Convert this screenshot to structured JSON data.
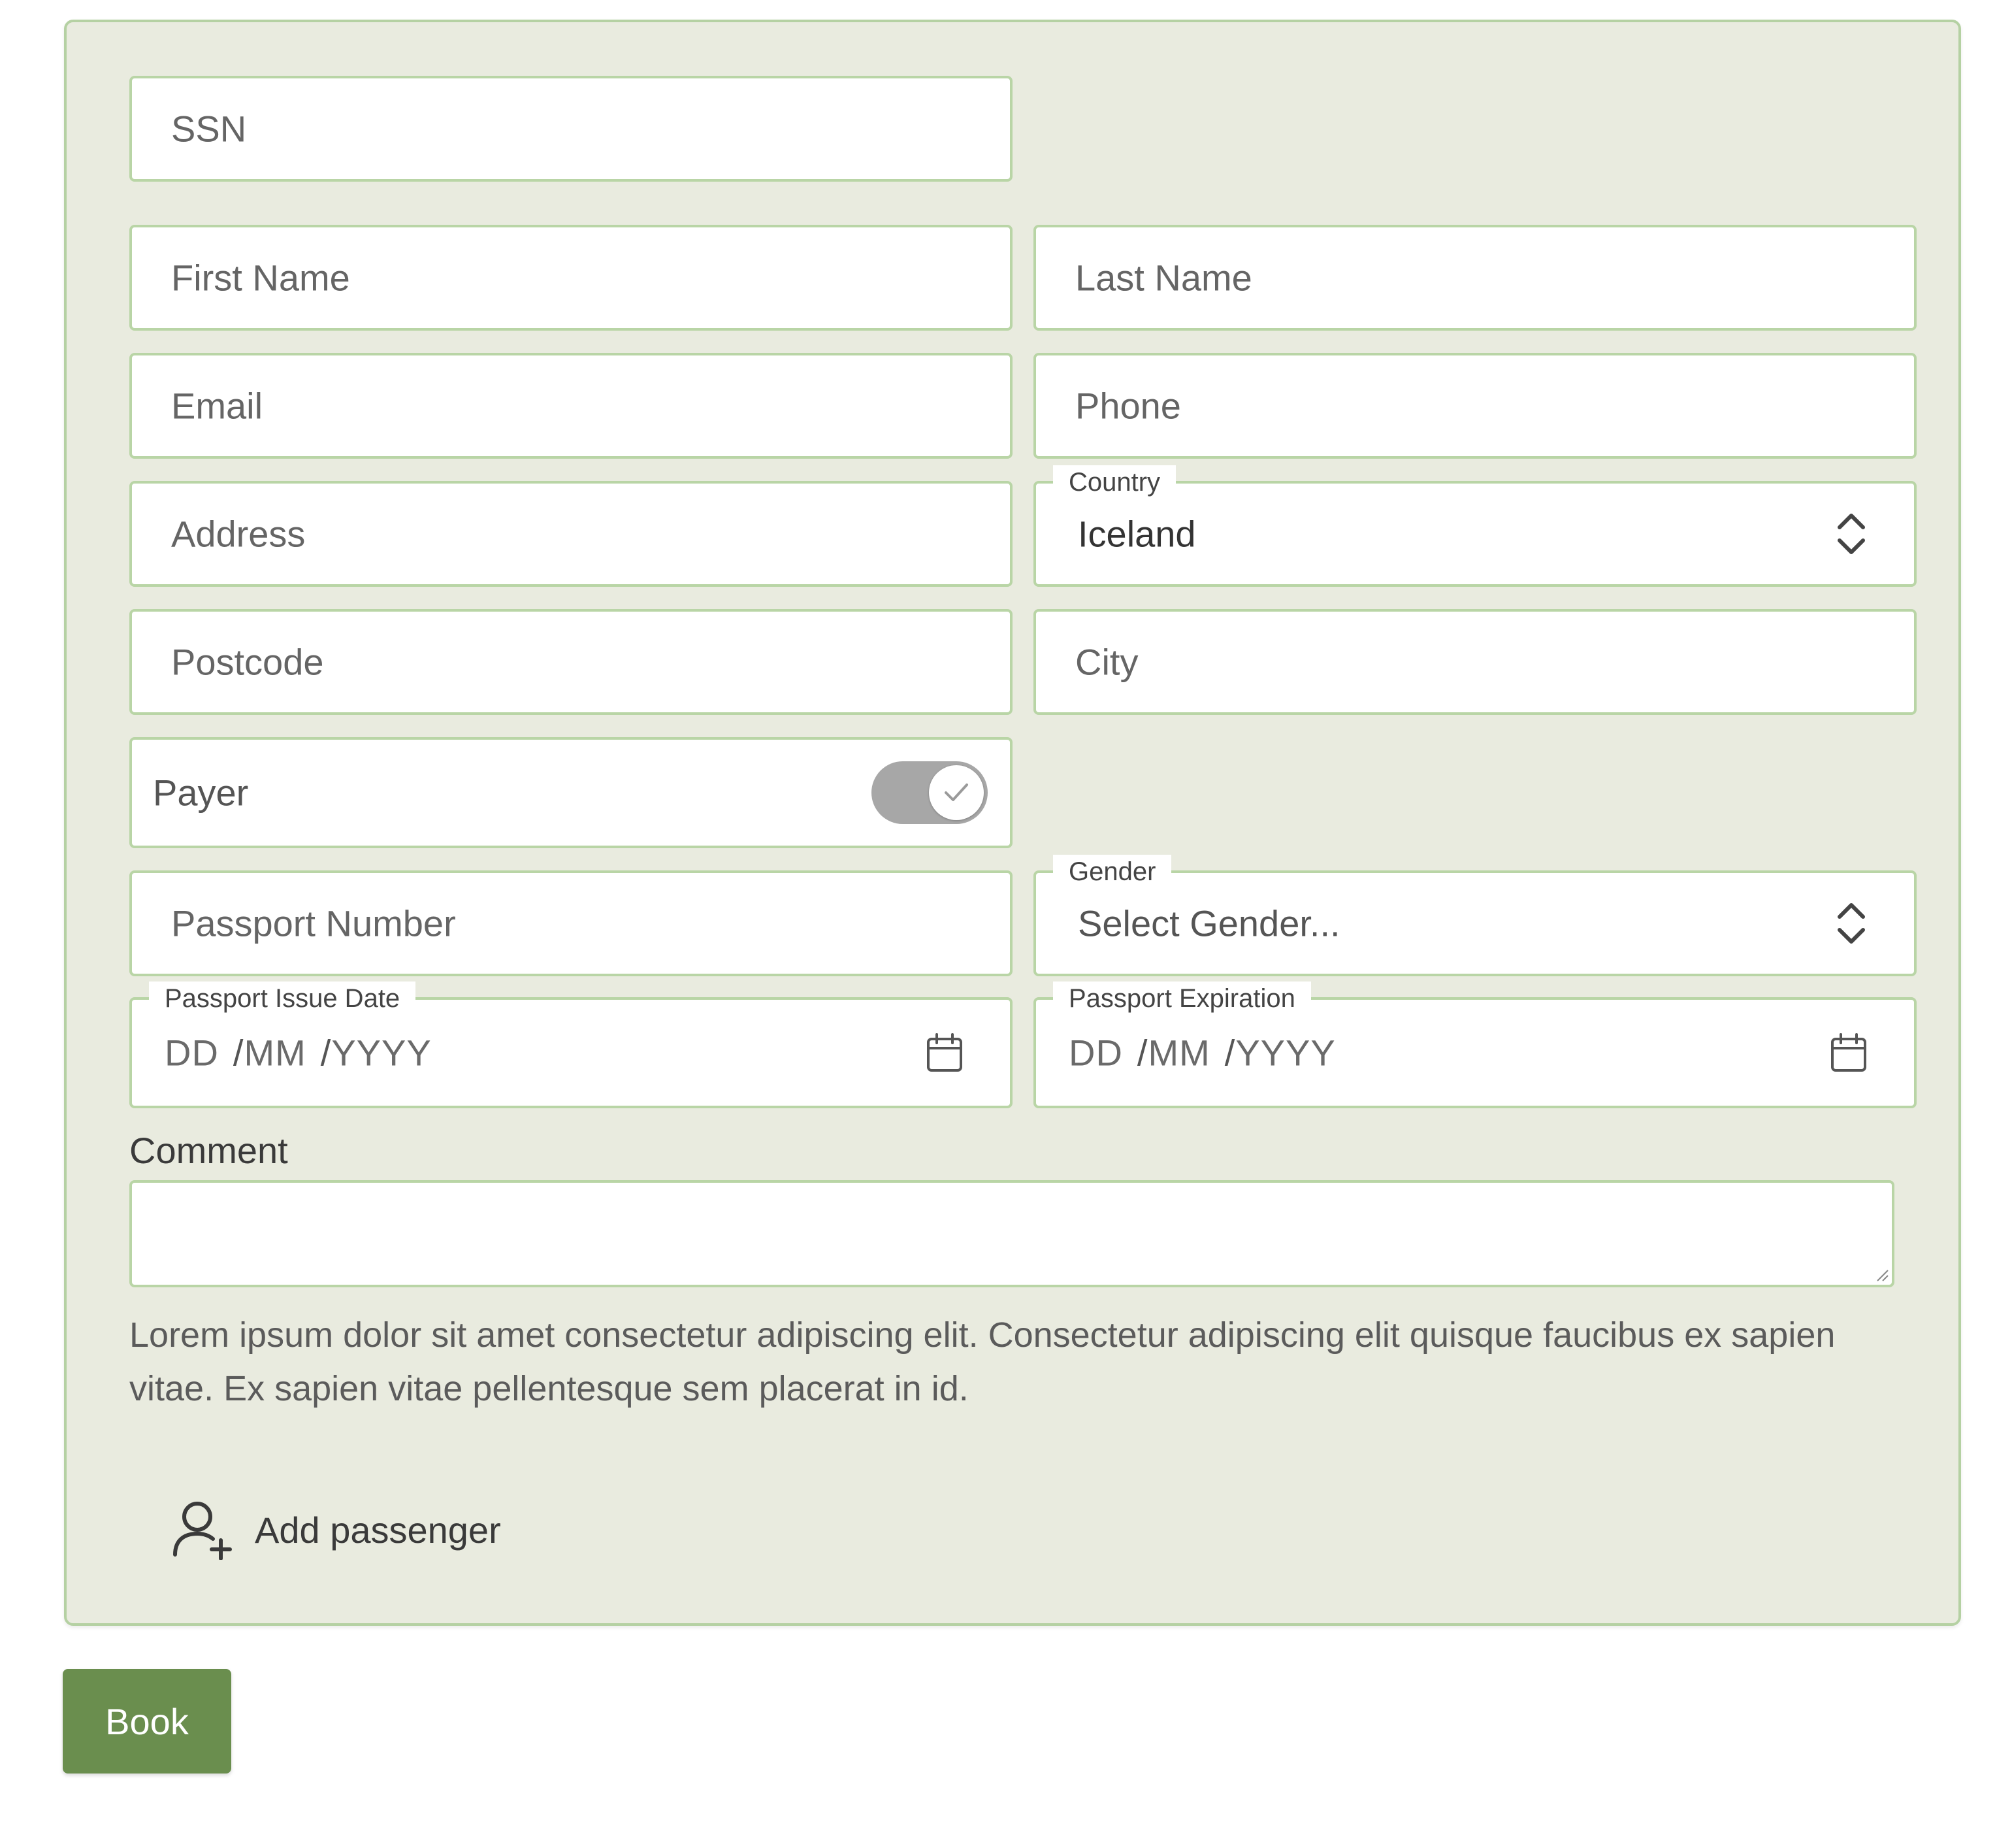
{
  "form": {
    "ssn": {
      "placeholder": "SSN"
    },
    "first_name": {
      "placeholder": "First Name"
    },
    "last_name": {
      "placeholder": "Last Name"
    },
    "email": {
      "placeholder": "Email"
    },
    "phone": {
      "placeholder": "Phone"
    },
    "address": {
      "placeholder": "Address"
    },
    "country": {
      "label": "Country",
      "value": "Iceland"
    },
    "postcode": {
      "placeholder": "Postcode"
    },
    "city": {
      "placeholder": "City"
    },
    "payer": {
      "label": "Payer",
      "checked": true
    },
    "passport_number": {
      "placeholder": "Passport Number"
    },
    "gender": {
      "label": "Gender",
      "value": "Select Gender..."
    },
    "passport_issue": {
      "label": "Passport Issue Date",
      "dd": "DD",
      "mm": "MM",
      "yyyy": "YYYY"
    },
    "passport_expiration": {
      "label": "Passport Expiration",
      "dd": "DD",
      "mm": "MM",
      "yyyy": "YYYY"
    },
    "comment": {
      "label": "Comment",
      "value": ""
    },
    "help_text": "Lorem ipsum dolor sit amet consectetur adipiscing elit. Consectetur adipiscing elit quisque faucibus ex sapien vitae. Ex sapien vitae pellentesque sem placerat in id.",
    "add_passenger": {
      "label": "Add passenger",
      "icon": "user-plus-icon"
    }
  },
  "actions": {
    "book_label": "Book"
  },
  "colors": {
    "panel_bg": "#e9ebdf",
    "border": "#b9d5a6",
    "button_bg": "#6a8e4e",
    "toggle_bg": "#a7a7a7"
  }
}
